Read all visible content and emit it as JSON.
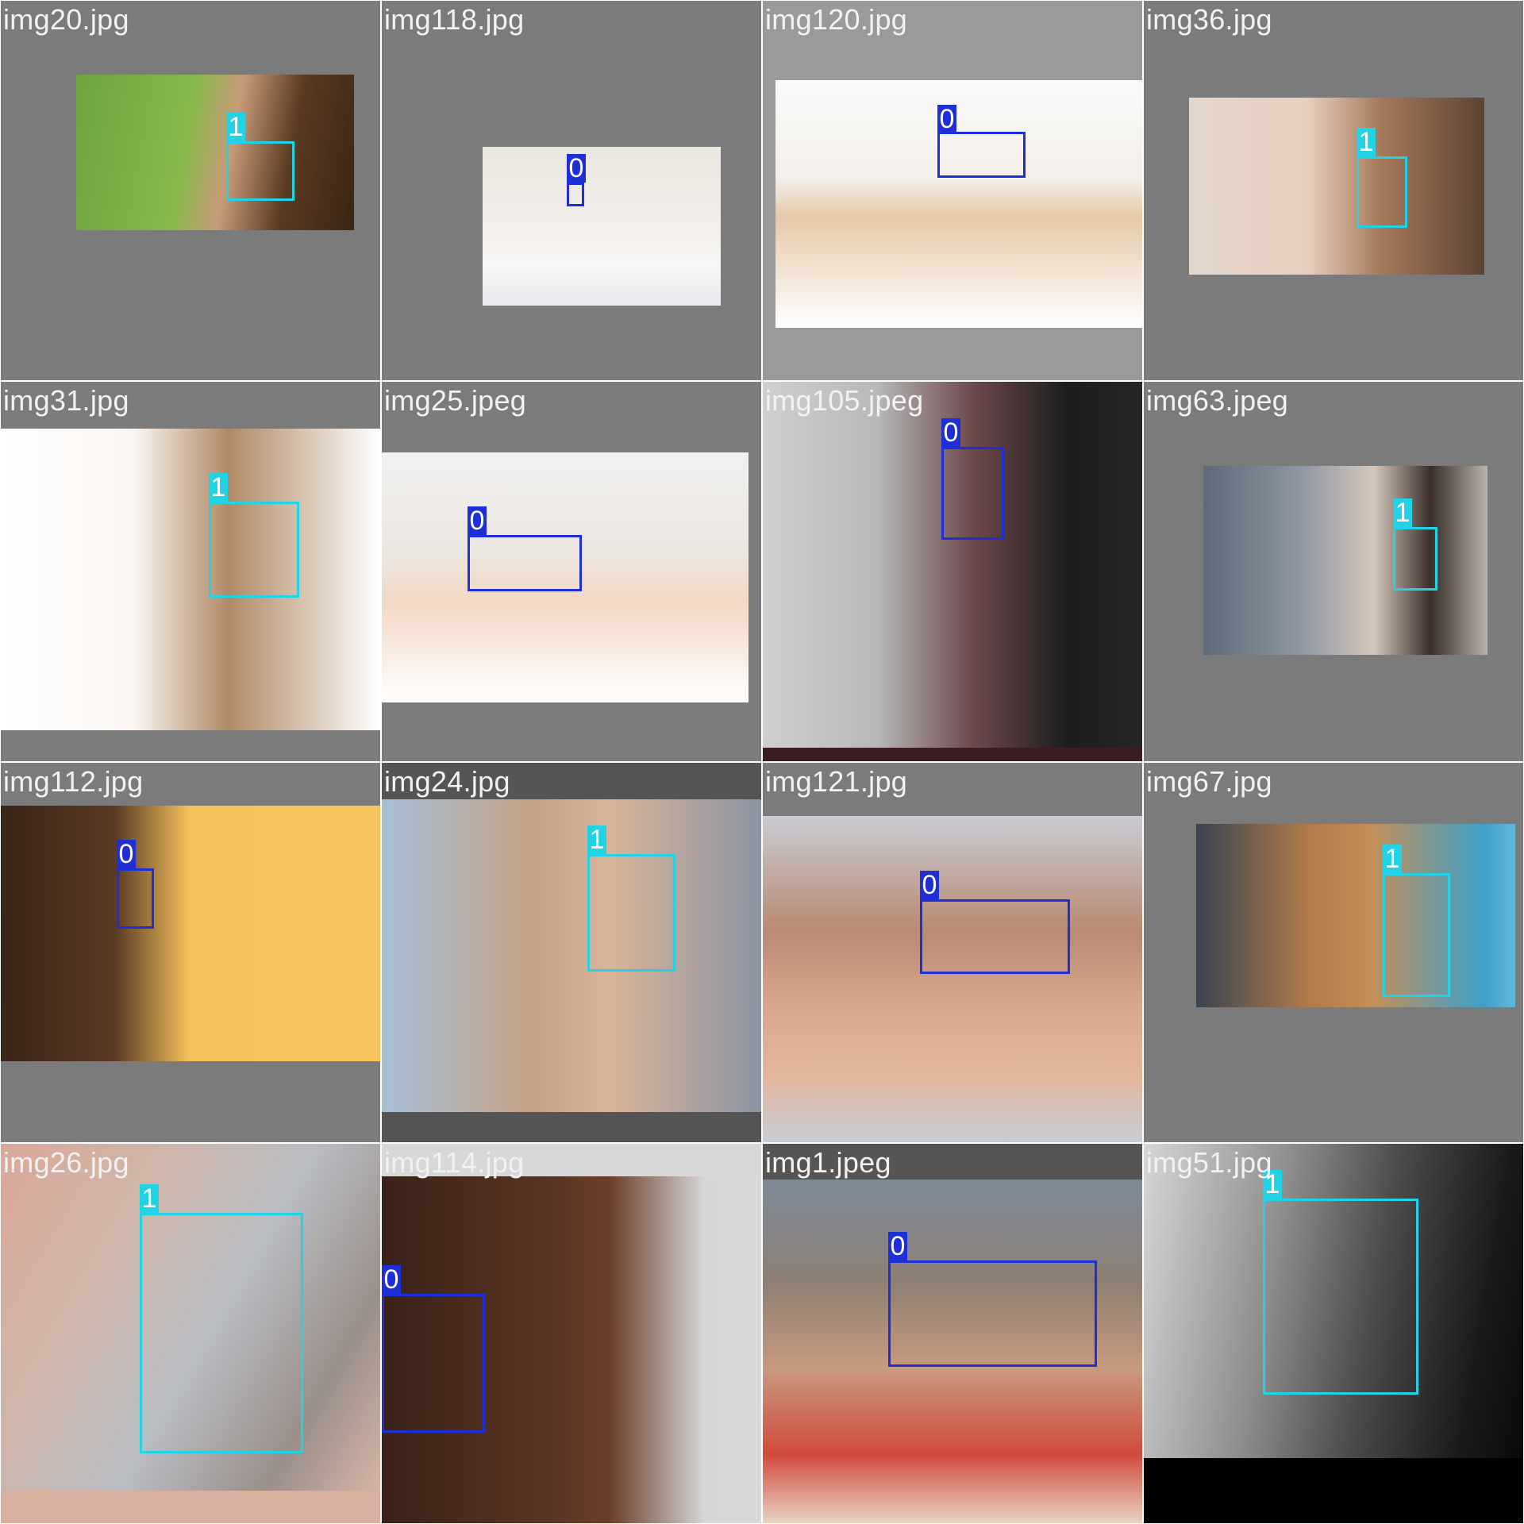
{
  "title": "",
  "class_colors": {
    "0": "#1f2fd8",
    "1": "#22d3e6"
  },
  "tiles": [
    {
      "name": "img20.jpg",
      "bg": "#7b7b7b",
      "photo": "linear-gradient(100deg,#6ea33e 0%,#88b84a 40%,#c89b78 55%,#5a3a22 75%,#3a2616 100%)",
      "label": "1"
    },
    {
      "name": "img118.jpg",
      "bg": "#7b7b7b",
      "photo": "linear-gradient(180deg,#eae6e0 0%,#f4f1ec 60%,#f7f7f7 75%,#e9e9ee 100%)",
      "label": "0"
    },
    {
      "name": "img120.jpg",
      "bg": "#9a9a9a",
      "photo": "linear-gradient(180deg,#fafafa 0%,#f3efe9 40%,#e6c9a8 55%,#ffffff 100%)",
      "label": "0"
    },
    {
      "name": "img36.jpg",
      "bg": "#7b7b7b",
      "photo": "linear-gradient(90deg,#e4d7cc 0%,#e7cfbf 40%,#a6795a 65%,#5c4334 100%)",
      "label": "1"
    },
    {
      "name": "img31.jpg",
      "bg": "#7b7b7b",
      "photo": "linear-gradient(90deg,#ffffff 0%,#fbf6f2 35%,#b08a66 60%,#ffffff 100%)",
      "label": "1"
    },
    {
      "name": "img25.jpeg",
      "bg": "#7b7b7b",
      "photo": "linear-gradient(180deg,#f1f1f1 0%,#ece6e0 40%,#f2d8c4 60%,#ffffff 100%)",
      "label": "0"
    },
    {
      "name": "img105.jpeg",
      "bg": "#3a1e24",
      "photo": "linear-gradient(90deg,#cfcfcf 0%,#b8b8b8 30%,#6e4a4e 55%,#1d1d1d 80%,#262626 100%)",
      "label": "0"
    },
    {
      "name": "img63.jpeg",
      "bg": "#7b7b7b",
      "photo": "linear-gradient(90deg,#5e6a78 0%,#8f98a4 35%,#d5c7bb 60%,#3a2e2a 80%,#b9b3ab 100%)",
      "label": "1"
    },
    {
      "name": "img112.jpg",
      "bg": "#7b7b7b",
      "photo": "linear-gradient(90deg,#3a2518 0%,#5a3a24 30%,#f5c25c 50%,#f7c45d 100%)",
      "label": "0"
    },
    {
      "name": "img24.jpg",
      "bg": "#555555",
      "photo": "linear-gradient(90deg,#a7c0d8 0%,#c4a184 40%,#d8b49a 60%,#8b93a3 100%)",
      "label": "1"
    },
    {
      "name": "img121.jpg",
      "bg": "#7b7b7b",
      "photo": "linear-gradient(180deg,#c9ccd4 0%,#b98a72 35%,#d9a98f 60%,#e3b79c 80%,#c8ccd6 100%)",
      "label": "0"
    },
    {
      "name": "img67.jpg",
      "bg": "#7b7b7b",
      "photo": "linear-gradient(90deg,#3a4450 0%,#b07a4a 35%,#c48e5a 55%,#3fa0c8 90%,#63b8d8 100%)",
      "label": "1"
    },
    {
      "name": "img26.jpg",
      "bg": "#d8b0a0",
      "photo": "linear-gradient(120deg,#dba898 0%,#cfb6aa 30%,#b9bcc2 55%,#9a8f8a 80%,#d6b4a6 100%)",
      "label": "1"
    },
    {
      "name": "img114.jpg",
      "bg": "#d8d8d8",
      "photo": "linear-gradient(90deg,#3a2218 0%,#5a3524 45%,#6b3e2a 60%,#d6d6d6 85%,#d9d9d9 100%)",
      "label": "0"
    },
    {
      "name": "img1.jpeg",
      "bg": "#555555",
      "photo": "linear-gradient(180deg,#7c8a98 0%,#8e7f74 30%,#c89a7e 55%,#d14a3c 80%,#e9d3c4 100%)",
      "label": "0"
    },
    {
      "name": "img51.jpg",
      "bg": "#000000",
      "photo": "linear-gradient(100deg,#d6d6d6 0%,#8c8c8c 35%,#4a4a4a 60%,#1a1a1a 85%,#0a0a0a 100%)",
      "label": "1"
    }
  ]
}
